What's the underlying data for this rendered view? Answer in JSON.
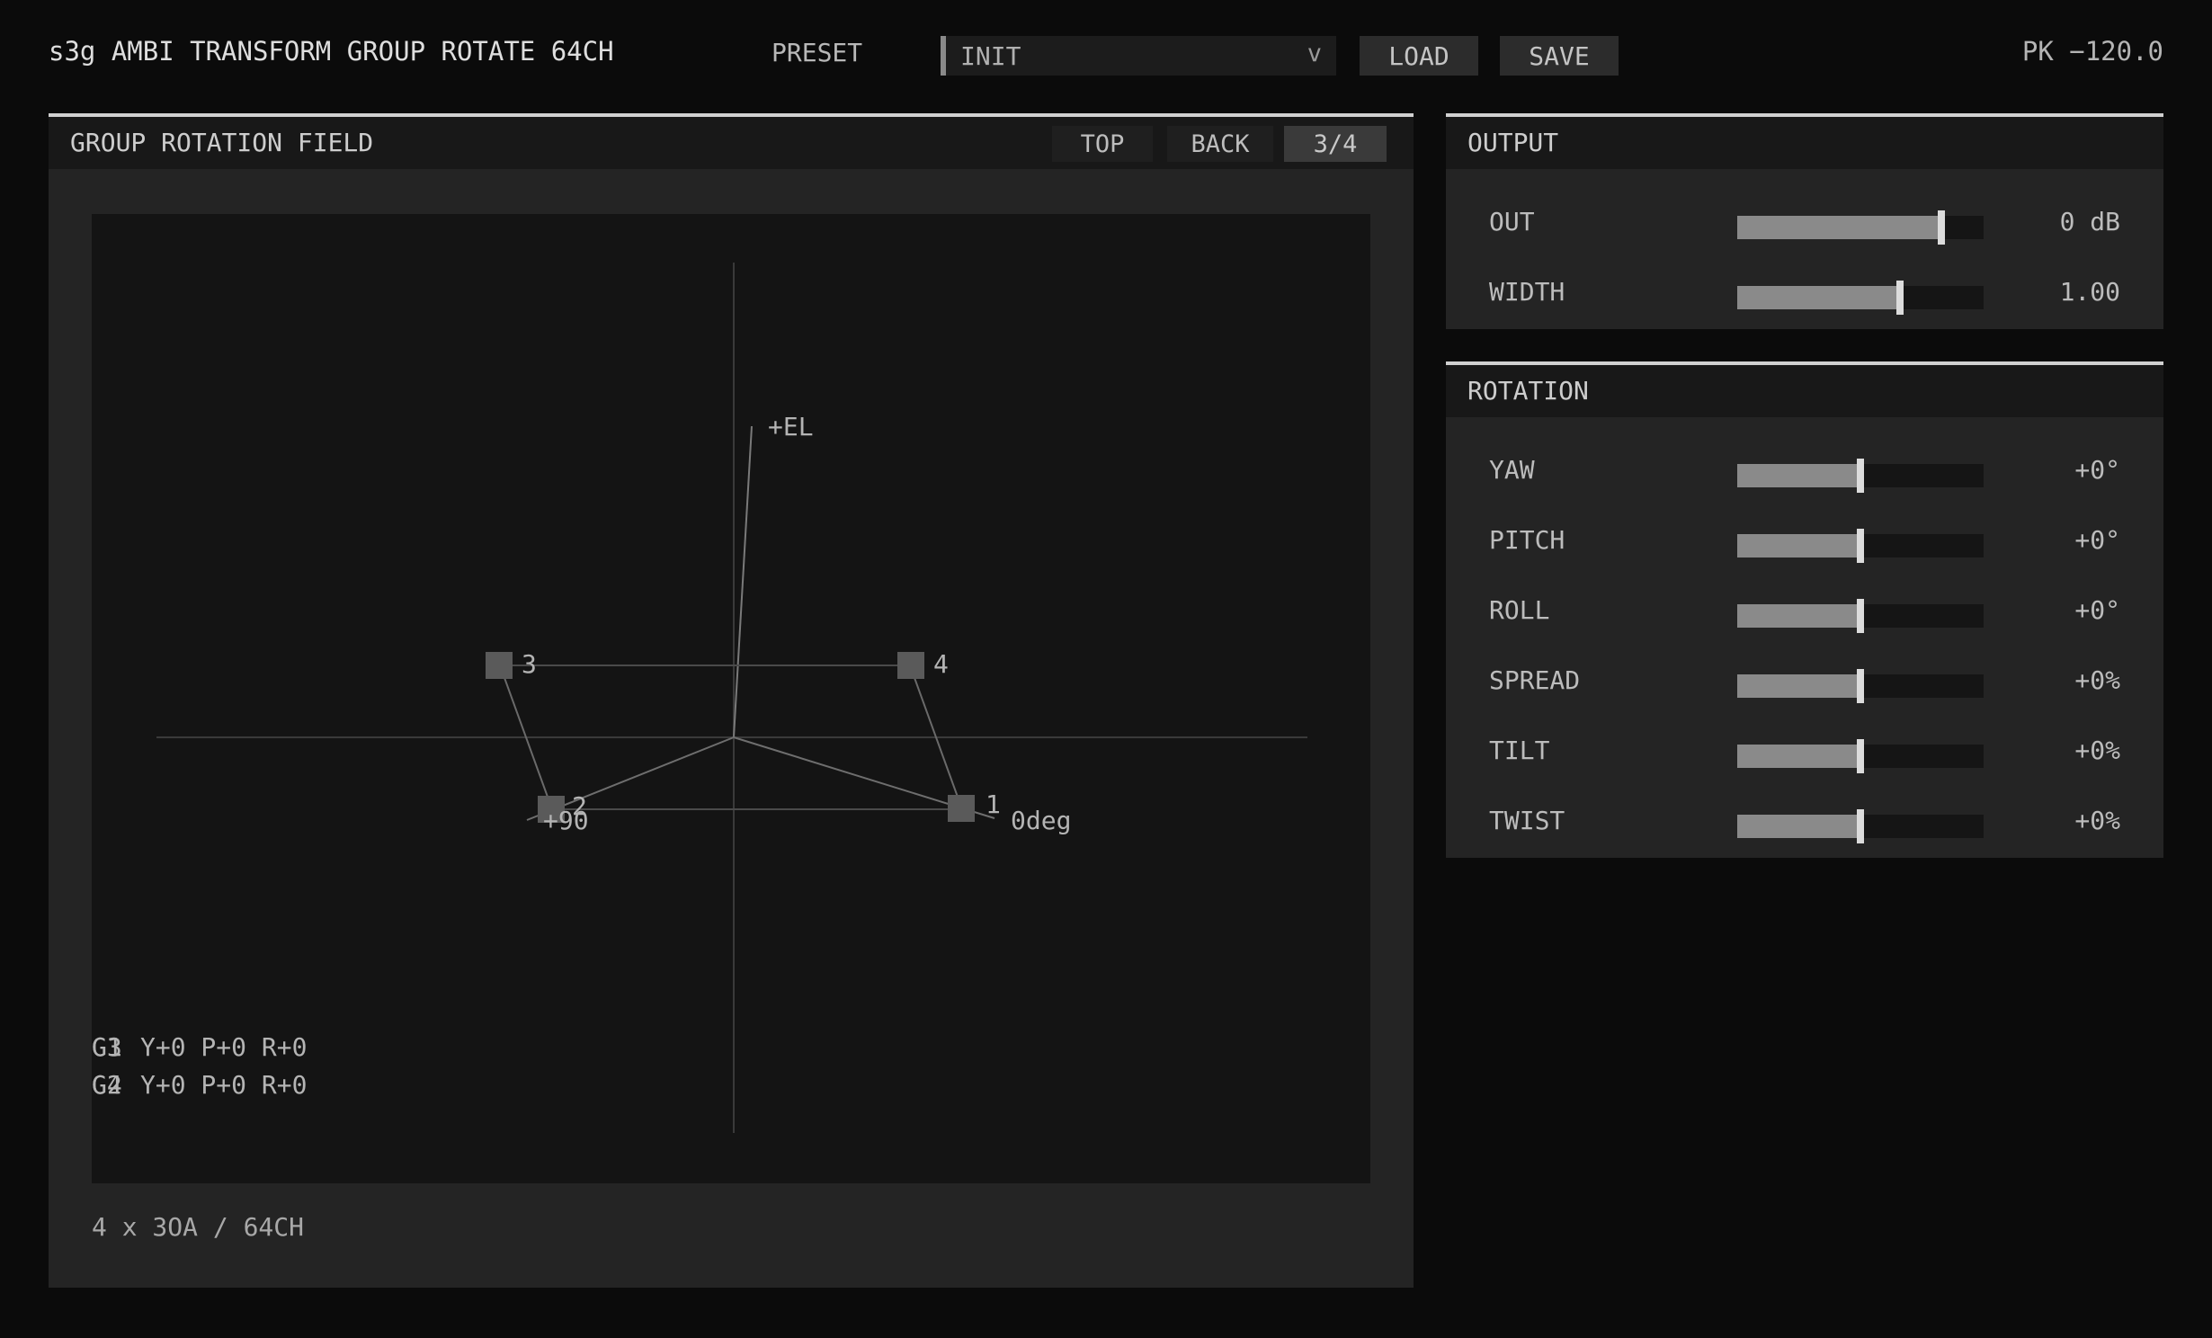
{
  "header": {
    "title": "s3g AMBI TRANSFORM GROUP ROTATE 64CH",
    "preset_label": "PRESET",
    "preset_value": "INIT",
    "preset_chevron": "v",
    "load_label": "LOAD",
    "save_label": "SAVE",
    "peak": "PK −120.0"
  },
  "field": {
    "title": "GROUP ROTATION FIELD",
    "tabs": [
      "TOP",
      "BACK",
      "3/4"
    ],
    "axis_labels": {
      "elevation": "+EL",
      "azimuth_zero": "0deg",
      "azimuth_90": "+90"
    },
    "speakers": [
      "1",
      "2",
      "3",
      "4"
    ],
    "group_status": [
      {
        "group_a": "G1",
        "group_b": "G3",
        "text": "Y+0 P+0 R+0"
      },
      {
        "group_a": "G2",
        "group_b": "G4",
        "text": "Y+0 P+0 R+0"
      }
    ],
    "footer": "4 x 3OA / 64CH"
  },
  "output": {
    "title": "OUTPUT",
    "params": [
      {
        "label": "OUT",
        "value": "0 dB",
        "level": 0.83
      },
      {
        "label": "WIDTH",
        "value": "1.00",
        "level": 0.66
      }
    ]
  },
  "rotation": {
    "title": "ROTATION",
    "params": [
      {
        "label": "YAW",
        "value": "+0°",
        "level": 0.5
      },
      {
        "label": "PITCH",
        "value": "+0°",
        "level": 0.5
      },
      {
        "label": "ROLL",
        "value": "+0°",
        "level": 0.5
      },
      {
        "label": "SPREAD",
        "value": "+0%",
        "level": 0.5
      },
      {
        "label": "TILT",
        "value": "+0%",
        "level": 0.5
      },
      {
        "label": "TWIST",
        "value": "+0%",
        "level": 0.5
      }
    ]
  },
  "colors": {
    "background": "#0b0b0b",
    "panel": "#242424",
    "canvas": "#141414",
    "accent": "#d0d0d0"
  }
}
